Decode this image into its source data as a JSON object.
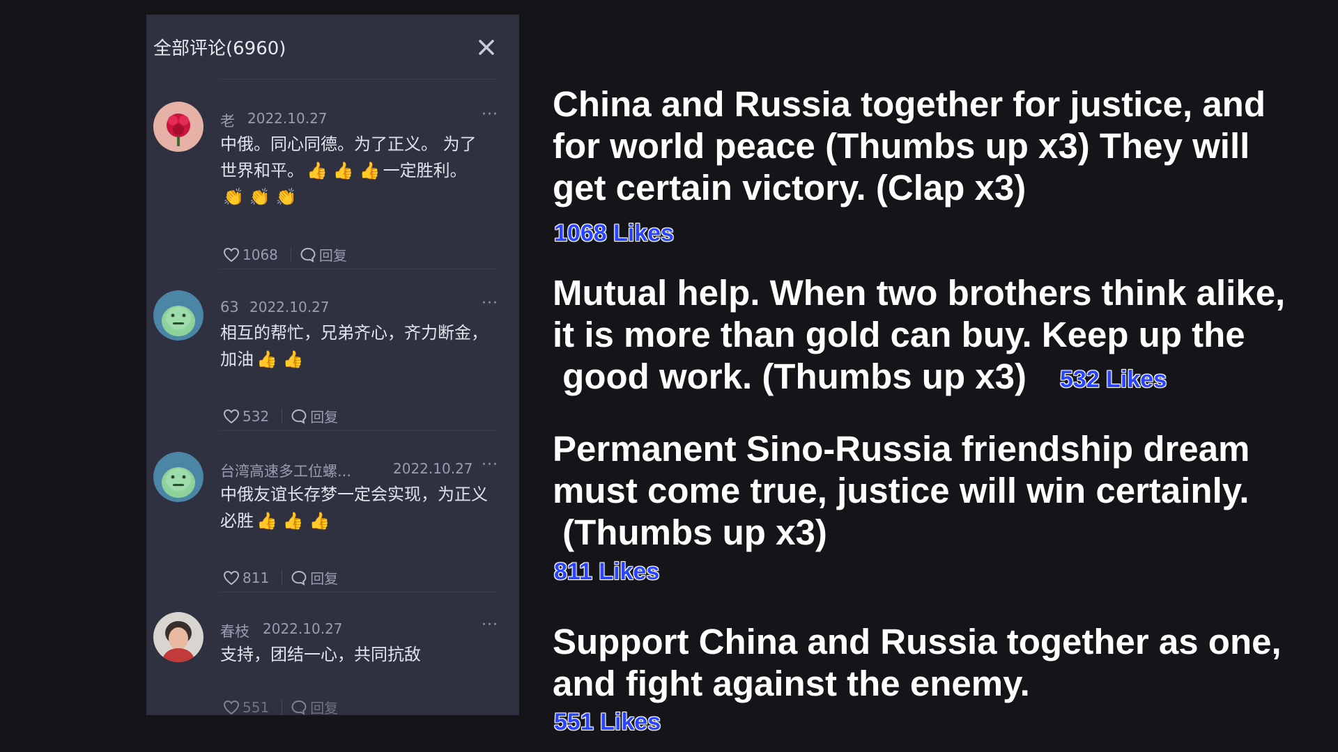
{
  "panel": {
    "title": "全部评论(6960)",
    "reply_label": "回复",
    "more_label": "···"
  },
  "comments": [
    {
      "user": "老",
      "date": "2022.10.27",
      "text_line1": "中俄。同心同德。为了正义。 为了",
      "text_line2": "世界和平。",
      "text_line2_tail": "一定胜利。",
      "likes": "1068"
    },
    {
      "user": "63",
      "date": "2022.10.27",
      "text_line1": "相互的帮忙，兄弟齐心，齐力断金，",
      "text_line2": "加油",
      "likes": "532"
    },
    {
      "user": "台湾高速多工位螺...",
      "date": "2022.10.27",
      "text_line1": "中俄友谊长存梦一定会实现，为正义",
      "text_line2": "必胜",
      "likes": "811"
    },
    {
      "user": "春枝",
      "date": "2022.10.27",
      "text_line1": "支持，团结一心，共同抗敌",
      "likes": "551"
    }
  ],
  "translations": [
    {
      "lines": [
        "China and Russia together for justice, and",
        "for world peace (Thumbs up x3) They will",
        "get certain victory. (Clap x3)"
      ],
      "likes": "1068 Likes"
    },
    {
      "lines": [
        "Mutual help. When two brothers think alike,",
        "it is more than gold can buy. Keep up the",
        " good work. (Thumbs up x3)"
      ],
      "likes": "532 Likes"
    },
    {
      "lines": [
        "Permanent Sino-Russia friendship dream",
        "must come true, justice will win certainly.",
        " (Thumbs up x3)"
      ],
      "likes": "811 Likes"
    },
    {
      "lines": [
        "Support China and Russia together as one,",
        "and fight against the enemy."
      ],
      "likes": "551 Likes"
    }
  ],
  "icons": {
    "thumbs": "👍",
    "clap": "👏"
  },
  "colors": {
    "background": "#151519",
    "panel": "#2f3140",
    "likes_text": "#2b45ff"
  }
}
